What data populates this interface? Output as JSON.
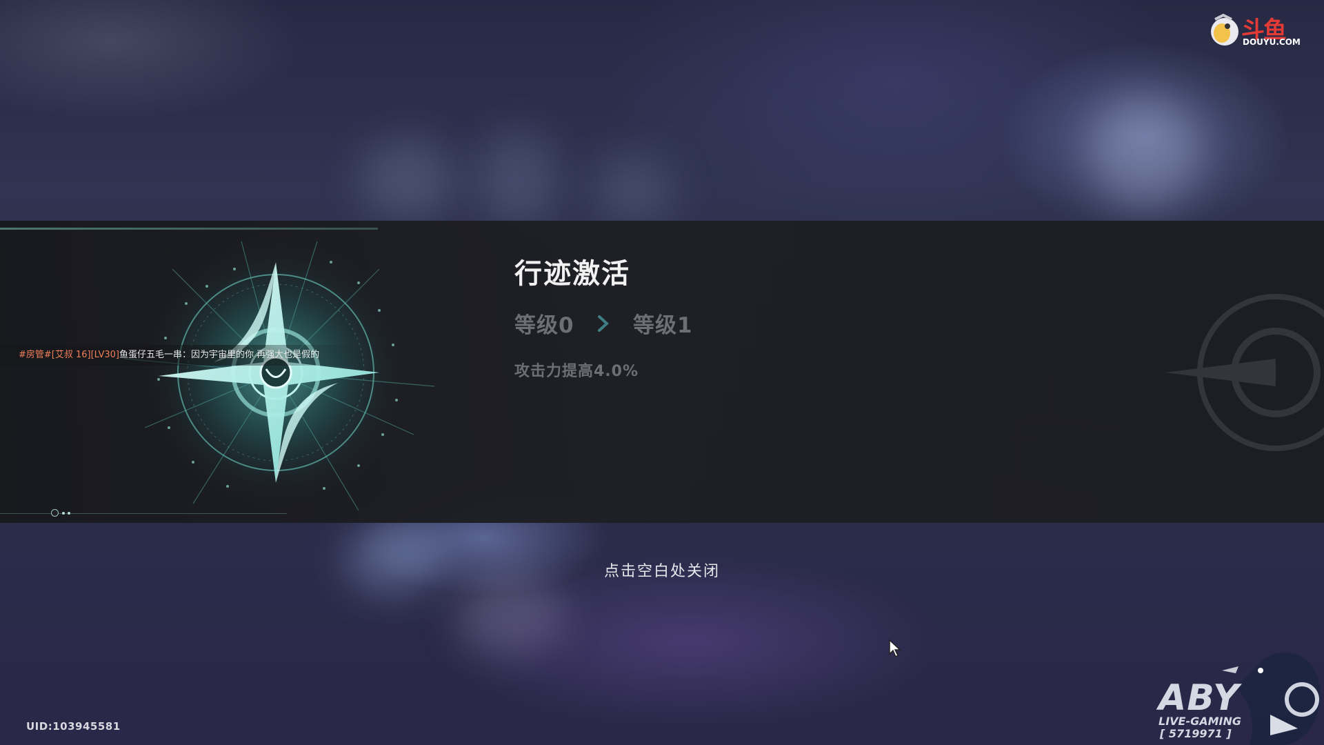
{
  "panel": {
    "title": "行迹激活",
    "level_from": "等级0",
    "level_to": "等级1",
    "effect": "攻击力提高4.0%",
    "close_hint": "点击空白处关闭",
    "pager": {
      "pages": 3,
      "current": 1
    }
  },
  "overlay": {
    "danmaku_prefix": "#房管#[艾叔 16][LV30]",
    "danmaku_user": "鱼蛋仔五毛一串",
    "danmaku_message": "：因为宇宙里的你 再强大也是假的",
    "uid": "UID:103945581",
    "douyu_logo_cn": "斗鱼",
    "douyu_logo_en": "DOUYU.COM",
    "streamer_logo": "ABY",
    "streamer_sub": "LIVE-GAMING",
    "streamer_room": "[ 5719971 ]"
  },
  "colors": {
    "accent_teal": "#7fe8df",
    "danmaku_prefix": "#f0805a",
    "logo_red": "#e23b35"
  },
  "icons": {
    "emblem": "trace-compass-emblem-icon",
    "arrow": "chevron-right-icon",
    "cursor": "mouse-pointer-icon"
  }
}
